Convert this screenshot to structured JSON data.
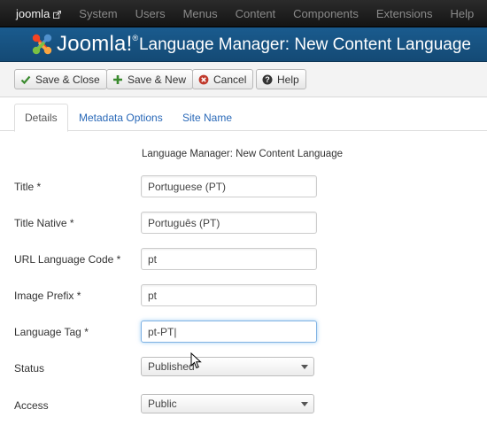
{
  "topbar": {
    "brand": "joomla",
    "brand_icon": "external-link-icon",
    "nav": [
      "System",
      "Users",
      "Menus",
      "Content",
      "Components",
      "Extensions",
      "Help"
    ]
  },
  "header": {
    "logo_text": "Joomla!",
    "logo_mark": "®",
    "title": "Language Manager: New Content Language"
  },
  "toolbar": {
    "save_close": "Save & Close",
    "save_new": "Save & New",
    "cancel": "Cancel",
    "help": "Help"
  },
  "tabs": {
    "details": "Details",
    "metadata": "Metadata Options",
    "site_name": "Site Name",
    "active": "Details"
  },
  "form": {
    "legend": "Language Manager: New Content Language",
    "title_label": "Title *",
    "title_value": "Portuguese (PT)",
    "title_native_label": "Title Native *",
    "title_native_value": "Português (PT)",
    "url_code_label": "URL Language Code *",
    "url_code_value": "pt",
    "image_prefix_label": "Image Prefix *",
    "image_prefix_value": "pt",
    "language_tag_label": "Language Tag *",
    "language_tag_value": "pt-PT|",
    "status_label": "Status",
    "status_value": "Published",
    "access_label": "Access",
    "access_value": "Public"
  },
  "colors": {
    "topbar": "#1c1c1c",
    "header": "#17507f",
    "link": "#2a69b8",
    "save_green": "#3a8a2e",
    "cancel_red": "#c0392b"
  }
}
